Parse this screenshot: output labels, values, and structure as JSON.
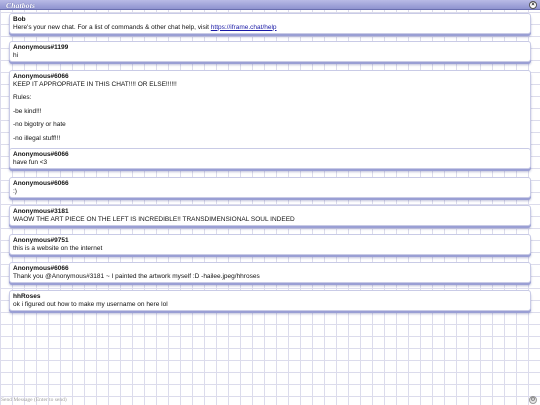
{
  "window": {
    "title": "Chatbots"
  },
  "messages": [
    {
      "author": "Bob",
      "lines": [
        "Here's your new chat. For a list of commands & other chat help, visit "
      ],
      "link": "https://iframe.chat/help"
    },
    {
      "author": "Anonymous#1199",
      "lines": [
        "hi"
      ]
    },
    {
      "author": "Anonymous#6066",
      "lines": [
        "KEEP IT APPROPRIATE IN THIS CHAT!!!! OR ELSE!!!!!!",
        "Rules:",
        "-be kind!!!",
        "-no bigotry or hate",
        "-no illegal stuff!!!"
      ]
    },
    {
      "author": "Anonymous#6066",
      "lines": [
        "have fun <3"
      ]
    },
    {
      "author": "Anonymous#6066",
      "lines": [
        ":)"
      ]
    },
    {
      "author": "Anonymous#3181",
      "lines": [
        "WAOW THE ART PIECE ON THE LEFT IS INCREDIBLE!! TRANSDIMENSIONAL SOUL INDEED"
      ]
    },
    {
      "author": "Anonymous#9751",
      "lines": [
        "this is a website on the internet"
      ]
    },
    {
      "author": "Anonymous#6066",
      "lines": [
        "Thank you @Anonymous#3181 ~ I painted the artwork myself :D -hailee.jpeg/hhroses"
      ]
    },
    {
      "author": "hhRoses",
      "lines": [
        "ok i figured out how to make my username on here lol"
      ]
    }
  ],
  "composer": {
    "placeholder": "Send Message (Enter to send)"
  },
  "icons": {
    "close": "close-icon",
    "settings": "settings-icon"
  }
}
